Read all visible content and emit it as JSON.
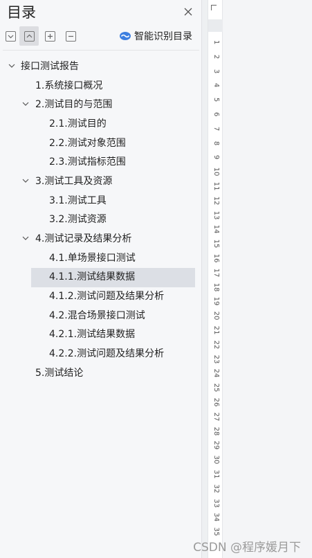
{
  "panel": {
    "title": "目录",
    "smart_toc_label": "智能识别目录"
  },
  "toolbar": {
    "buttons": [
      "collapse-all",
      "expand-all",
      "add",
      "remove"
    ]
  },
  "tree": [
    {
      "label": "接口测试报告",
      "level": 0,
      "expanded": true
    },
    {
      "label": "1.系统接口概况",
      "level": 1
    },
    {
      "label": "2.测试目的与范围",
      "level": 1,
      "expanded": true
    },
    {
      "label": "2.1.测试目的",
      "level": 2
    },
    {
      "label": "2.2.测试对象范围",
      "level": 2
    },
    {
      "label": "2.3.测试指标范围",
      "level": 2
    },
    {
      "label": "3.测试工具及资源",
      "level": 1,
      "expanded": true
    },
    {
      "label": "3.1.测试工具",
      "level": 2
    },
    {
      "label": "3.2.测试资源",
      "level": 2
    },
    {
      "label": "4.测试记录及结果分析",
      "level": 1,
      "expanded": true
    },
    {
      "label": "4.1.单场景接口测试",
      "level": 2
    },
    {
      "label": "4.1.1.测试结果数据",
      "level": 2,
      "selected": true
    },
    {
      "label": "4.1.2.测试问题及结果分析",
      "level": 2
    },
    {
      "label": "4.2.混合场景接口测试",
      "level": 2
    },
    {
      "label": "4.2.1.测试结果数据",
      "level": 2
    },
    {
      "label": "4.2.2.测试问题及结果分析",
      "level": 2
    },
    {
      "label": "5.测试结论",
      "level": 1
    }
  ],
  "ruler": {
    "numbers": [
      "1",
      "2",
      "3",
      "4",
      "5",
      "6",
      "7",
      "8",
      "9",
      "10",
      "11",
      "12",
      "13",
      "14",
      "15",
      "16",
      "17",
      "18",
      "19",
      "20",
      "21",
      "22",
      "23",
      "24",
      "25",
      "26",
      "27",
      "28",
      "29",
      "30",
      "31",
      "32",
      "33",
      "34",
      "35"
    ]
  },
  "watermark": "CSDN @程序媛月下",
  "colors": {
    "panel_bg": "#f6f7f9",
    "selected_bg": "#dcdfe5",
    "accent_blue": "#3d7fe0"
  }
}
